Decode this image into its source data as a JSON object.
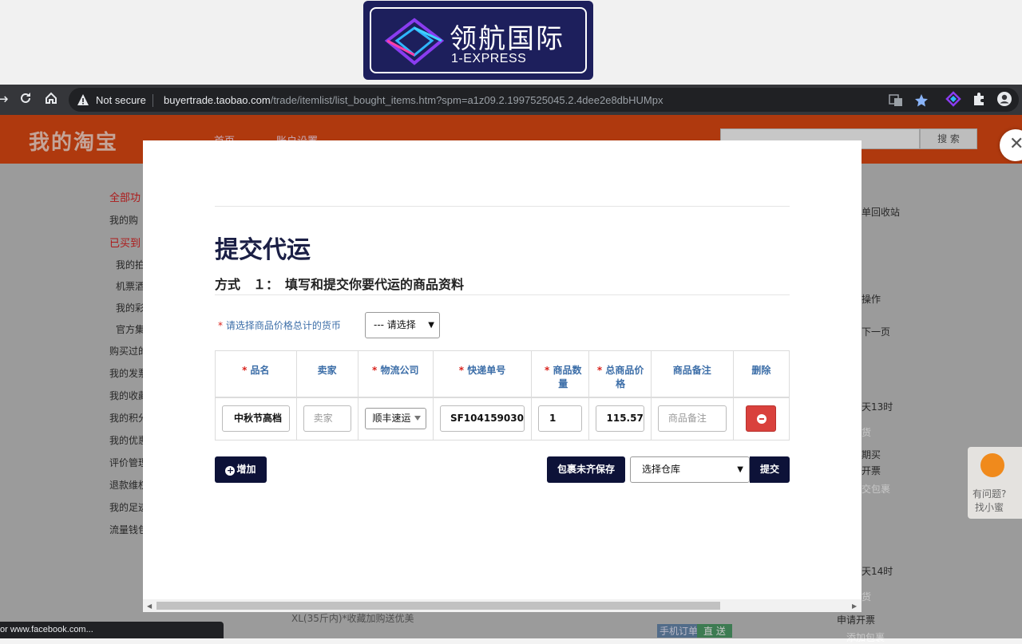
{
  "logo": {
    "cn": "领航国际",
    "en": "1-EXPRESS"
  },
  "browser": {
    "not_secure": "Not secure",
    "url_host": "buyertrade.taobao.com",
    "url_path": "/trade/itemlist/list_bought_items.htm?spm=a1z09.2.1997525045.2.4dee2e8dbHUMpx"
  },
  "taobao": {
    "title": "我的淘宝",
    "nav_home": "首页",
    "nav_account": "账户设置",
    "search_btn": "搜 索",
    "sidebar": [
      "全部功",
      "我的购",
      "已买到",
      "我的拍",
      "机票酒",
      "我的彩",
      "官方集",
      "购买过的",
      "我的发票",
      "我的收藏",
      "我的积分",
      "我的优惠",
      "评价管理",
      "退款维权",
      "我的足迹",
      "流量钱包"
    ],
    "right": {
      "recycle": "单回收站",
      "ops": "操作",
      "next": "下一页",
      "t1": "天13时",
      "t2": "货",
      "t3": "期买",
      "t4": "开票",
      "t5": "交包裹",
      "t6": "天14时",
      "t7": "申请开票",
      "t8": "添加包裹",
      "mobile_order": "手机订单",
      "direct": "直 送",
      "item_text": "XL(35斤内)*收藏加购送优美"
    }
  },
  "modal": {
    "title": "提交代运",
    "subtitle": "方式　１：　填写和提交你要代运的商品资料",
    "currency_label": "请选择商品价格总计的货币",
    "currency_value": "--- 请选择",
    "required_mark": "*",
    "headers": {
      "name": "品名",
      "seller": "卖家",
      "logistics": "物流公司",
      "tracking": "快递单号",
      "quantity": "商品数量",
      "total_price": "总商品价格",
      "note": "商品备注",
      "delete": "删除"
    },
    "row": {
      "name": "中秋节高档",
      "seller_placeholder": "卖家",
      "logistics": "顺丰速运",
      "tracking": "SF104159030",
      "quantity": "1",
      "total_price": "115.57",
      "note_placeholder": "商品备注"
    },
    "add_label": "增加",
    "save_label": "包裹未齐保存",
    "warehouse_value": "选择仓库",
    "submit_label": "提交"
  },
  "helper": {
    "line1": "有问题?",
    "line2": "找小蜜"
  },
  "status_url": "or www.facebook.com..."
}
